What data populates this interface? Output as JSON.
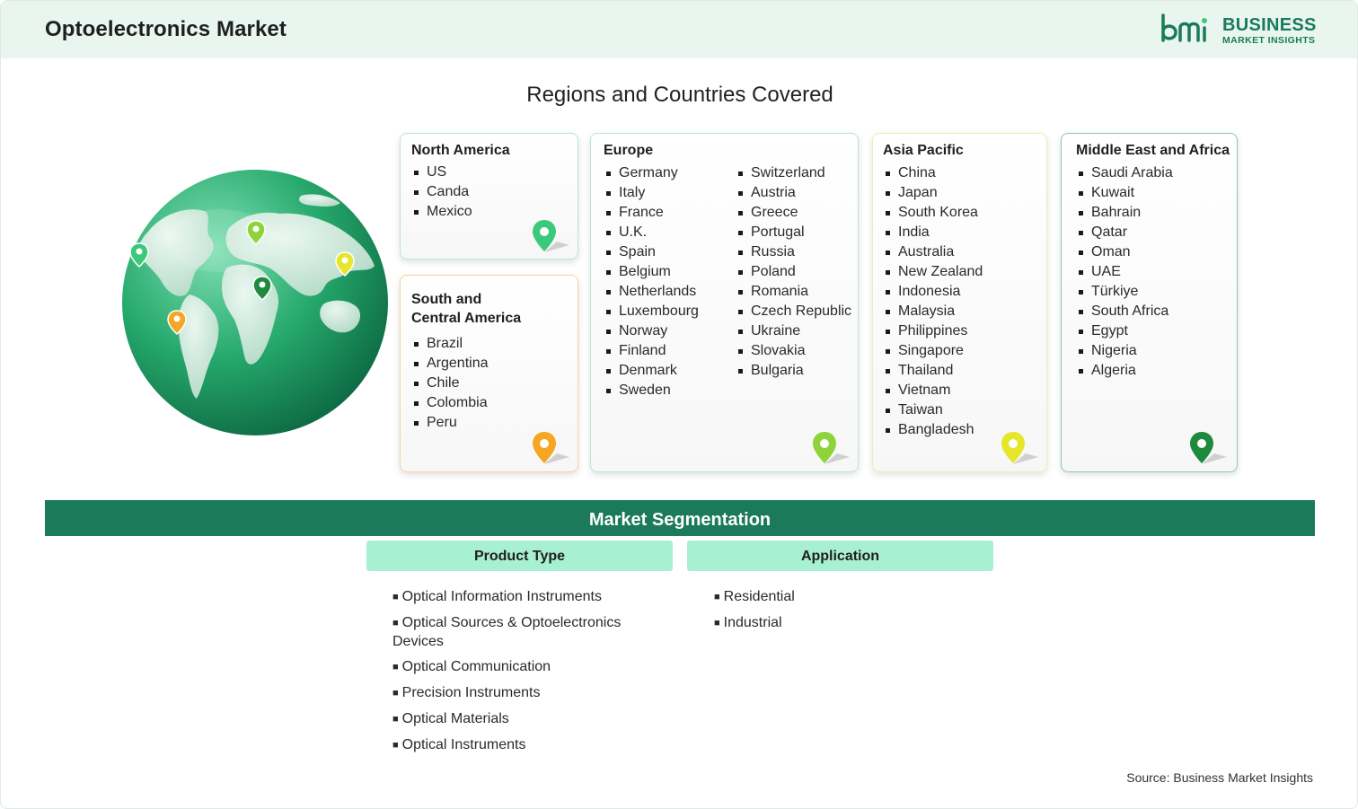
{
  "header": {
    "title": "Optoelectronics Market",
    "logo_line1": "BUSINESS",
    "logo_line2": "MARKET INSIGHTS"
  },
  "regions_title": "Regions and Countries Covered",
  "regions": {
    "north_america": {
      "name": "North America",
      "countries": [
        "US",
        "Canda",
        "Mexico"
      ],
      "pin_color": "#3cc97a"
    },
    "south_america": {
      "name_line1": "South and",
      "name_line2": "Central America",
      "countries": [
        "Brazil",
        "Argentina",
        "Chile",
        "Colombia",
        "Peru"
      ],
      "pin_color": "#f5a623"
    },
    "europe": {
      "name": "Europe",
      "countries_col1": [
        "Germany",
        "Italy",
        "France",
        "U.K.",
        "Spain",
        "Belgium",
        "Netherlands",
        "Luxembourg",
        "Norway",
        "Finland",
        "Denmark",
        "Sweden"
      ],
      "countries_col2": [
        "Switzerland",
        "Austria",
        "Greece",
        "Portugal",
        "Russia",
        "Poland",
        "Romania",
        "Czech Republic",
        "Ukraine",
        "Slovakia",
        "Bulgaria"
      ],
      "pin_color": "#8fd33a"
    },
    "asia_pacific": {
      "name": "Asia Pacific",
      "countries": [
        "China",
        "Japan",
        "South Korea",
        "India",
        "Australia",
        "New Zealand",
        "Indonesia",
        "Malaysia",
        "Philippines",
        "Singapore",
        "Thailand",
        "Vietnam",
        "Taiwan",
        "Bangladesh"
      ],
      "pin_color": "#e6e62a"
    },
    "mea": {
      "name": "Middle East and Africa",
      "countries": [
        "Saudi Arabia",
        "Kuwait",
        "Bahrain",
        "Qatar",
        "Oman",
        "UAE",
        "Türkiye",
        "South Africa",
        "Egypt",
        "Nigeria",
        "Algeria"
      ],
      "pin_color": "#1e8a3c"
    }
  },
  "segmentation": {
    "title": "Market Segmentation",
    "product_type": {
      "label": "Product Type",
      "items": [
        "Optical Information Instruments",
        "Optical Sources & Optoelectronics Devices",
        "Optical Communication",
        "Precision Instruments",
        "Optical Materials",
        "Optical Instruments"
      ]
    },
    "application": {
      "label": "Application",
      "items": [
        "Residential",
        "Industrial"
      ]
    }
  },
  "source": "Source: Business Market Insights",
  "colors": {
    "brand": "#1b7a5a",
    "header_bg": "#e8f6ef",
    "segment_header": "#a8f0d2"
  }
}
